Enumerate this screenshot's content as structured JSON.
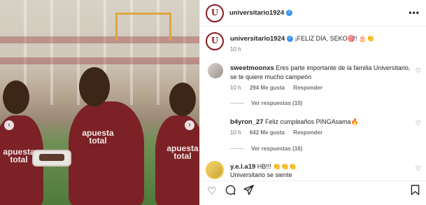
{
  "post": {
    "photo_alt_text_shirt": "apuesta total",
    "shirt_left": "apuesta total",
    "shirt_center": "apuesta total",
    "shirt_right": "apuesta total"
  },
  "header": {
    "username": "universitario1924",
    "more_icon": "•••"
  },
  "caption": {
    "username": "universitario1924",
    "text": "¡FELIZ DÍA, SEKO🎯! 🎂👏",
    "time": "10 h"
  },
  "comments": [
    {
      "username": "sweetmoonxs",
      "text": "Eres parte importante de la familia Universitario, se te quiere mucho campeón",
      "time": "10 h",
      "likes": "294 Me gusta",
      "reply": "Responder",
      "view_replies": "Ver respuestas (10)"
    },
    {
      "username": "b4yron_27",
      "text": "Feliz cumpleaños PINGAsama🔥",
      "time": "10 h",
      "likes": "642 Me gusta",
      "reply": "Responder",
      "view_replies": "Ver respuestas (16)"
    },
    {
      "username": "y.e.l.a19",
      "text": "HB!!! 👏👏👏",
      "text2": "Universitario se siente"
    }
  ],
  "icons": {
    "heart": "heart-icon",
    "comment": "comment-icon",
    "share": "share-icon",
    "save": "bookmark-icon"
  },
  "colors": {
    "brand": "#8b1a22",
    "verified": "#3897f0",
    "meta": "#737373"
  }
}
